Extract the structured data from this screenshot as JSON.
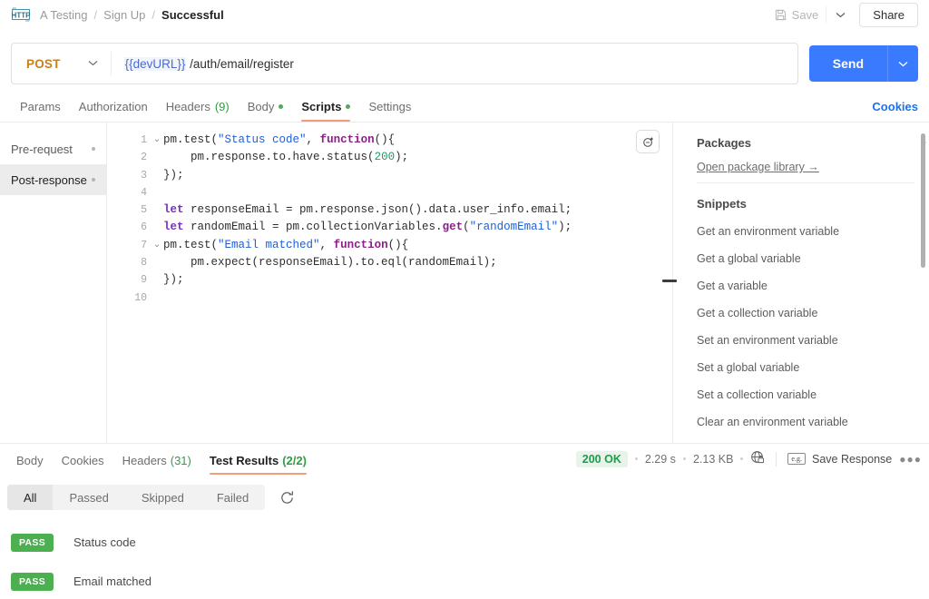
{
  "breadcrumb": {
    "icon": "http-badge-icon",
    "items": [
      {
        "label": "A Testing",
        "active": false
      },
      {
        "label": "Sign Up",
        "active": false
      },
      {
        "label": "Successful",
        "active": true
      }
    ],
    "separator": "/"
  },
  "topbar": {
    "save_label": "Save",
    "save_icon": "floppy-disk-icon",
    "save_caret_icon": "chevron-down-icon",
    "share_label": "Share"
  },
  "request": {
    "method": "POST",
    "method_caret_icon": "chevron-down-icon",
    "url_variable": "{{devURL}}",
    "url_path": " /auth/email/register",
    "send_label": "Send",
    "send_caret_icon": "chevron-down-icon"
  },
  "request_tabs": [
    {
      "label": "Params",
      "active": false,
      "dot": false,
      "count": ""
    },
    {
      "label": "Authorization",
      "active": false,
      "dot": false,
      "count": ""
    },
    {
      "label": "Headers",
      "active": false,
      "dot": false,
      "count": "(9)"
    },
    {
      "label": "Body",
      "active": false,
      "dot": true,
      "count": ""
    },
    {
      "label": "Scripts",
      "active": true,
      "dot": true,
      "count": ""
    },
    {
      "label": "Settings",
      "active": false,
      "dot": false,
      "count": ""
    }
  ],
  "cookies_link": "Cookies",
  "script_sidebar": [
    {
      "label": "Pre-request",
      "active": false,
      "dot": true
    },
    {
      "label": "Post-response",
      "active": true,
      "dot": true
    }
  ],
  "editor": {
    "magic_icon": "postbot-magic-icon",
    "lines": [
      {
        "n": "1",
        "fold": "⌄",
        "tokens": [
          {
            "t": "pm.test(",
            "c": "plain"
          },
          {
            "t": "\"Status code\"",
            "c": "k-str"
          },
          {
            "t": ", ",
            "c": "plain"
          },
          {
            "t": "function",
            "c": "k-fn"
          },
          {
            "t": "(){",
            "c": "plain"
          }
        ]
      },
      {
        "n": "2",
        "fold": "",
        "tokens": [
          {
            "t": "    ",
            "c": "ind-guide"
          },
          {
            "t": "pm.response.to.have.status(",
            "c": "plain"
          },
          {
            "t": "200",
            "c": "k-num"
          },
          {
            "t": ");",
            "c": "plain"
          }
        ]
      },
      {
        "n": "3",
        "fold": "",
        "tokens": [
          {
            "t": "});",
            "c": "plain"
          }
        ]
      },
      {
        "n": "4",
        "fold": "",
        "tokens": []
      },
      {
        "n": "5",
        "fold": "",
        "tokens": [
          {
            "t": "let",
            "c": "k-kw"
          },
          {
            "t": " responseEmail = pm.response.json().data.user_info.email;",
            "c": "plain"
          }
        ]
      },
      {
        "n": "6",
        "fold": "",
        "tokens": [
          {
            "t": "let",
            "c": "k-kw"
          },
          {
            "t": " randomEmail = pm.collectionVariables.",
            "c": "plain"
          },
          {
            "t": "get",
            "c": "k-fn"
          },
          {
            "t": "(",
            "c": "plain"
          },
          {
            "t": "\"randomEmail\"",
            "c": "k-str"
          },
          {
            "t": ");",
            "c": "plain"
          }
        ]
      },
      {
        "n": "7",
        "fold": "⌄",
        "tokens": [
          {
            "t": "pm.test(",
            "c": "plain"
          },
          {
            "t": "\"Email matched\"",
            "c": "k-str"
          },
          {
            "t": ", ",
            "c": "plain"
          },
          {
            "t": "function",
            "c": "k-fn"
          },
          {
            "t": "(){",
            "c": "plain"
          }
        ]
      },
      {
        "n": "8",
        "fold": "",
        "tokens": [
          {
            "t": "    ",
            "c": "ind-guide"
          },
          {
            "t": "pm.expect(responseEmail).to.eql(randomEmail);",
            "c": "plain"
          }
        ]
      },
      {
        "n": "9",
        "fold": "",
        "tokens": [
          {
            "t": "});",
            "c": "plain"
          }
        ]
      },
      {
        "n": "10",
        "fold": "",
        "tokens": []
      }
    ]
  },
  "snippets_panel": {
    "packages_title": "Packages",
    "package_library_link": "Open package library →",
    "snippets_title": "Snippets",
    "collapse_icon": "chevron-right-icon",
    "items": [
      "Get an environment variable",
      "Get a global variable",
      "Get a variable",
      "Get a collection variable",
      "Set an environment variable",
      "Set a global variable",
      "Set a collection variable",
      "Clear an environment variable"
    ]
  },
  "response_tabs": [
    {
      "label": "Body",
      "active": false,
      "count": ""
    },
    {
      "label": "Cookies",
      "active": false,
      "count": ""
    },
    {
      "label": "Headers",
      "active": false,
      "count": "(31)"
    },
    {
      "label": "Test Results",
      "active": true,
      "count": "(2/2)"
    }
  ],
  "response_meta": {
    "status": "200 OK",
    "time": "2.29 s",
    "size": "2.13 KB",
    "globe_icon": "globe-lock-icon",
    "eg_icon": "example-box-icon",
    "save_response_label": "Save Response",
    "more_icon": "more-options-icon"
  },
  "result_filters": [
    {
      "label": "All",
      "active": true
    },
    {
      "label": "Passed",
      "active": false
    },
    {
      "label": "Skipped",
      "active": false
    },
    {
      "label": "Failed",
      "active": false
    }
  ],
  "refresh_icon": "refresh-icon",
  "test_results": [
    {
      "status": "PASS",
      "name": "Status code"
    },
    {
      "status": "PASS",
      "name": "Email matched"
    }
  ],
  "colors": {
    "accent_blue": "#3a7afe",
    "method_orange": "#c7801a",
    "tab_underline": "#f09e78",
    "pass_green": "#4caf50",
    "status_green": "#1f9c4a",
    "link_blue": "#1a73e8"
  }
}
